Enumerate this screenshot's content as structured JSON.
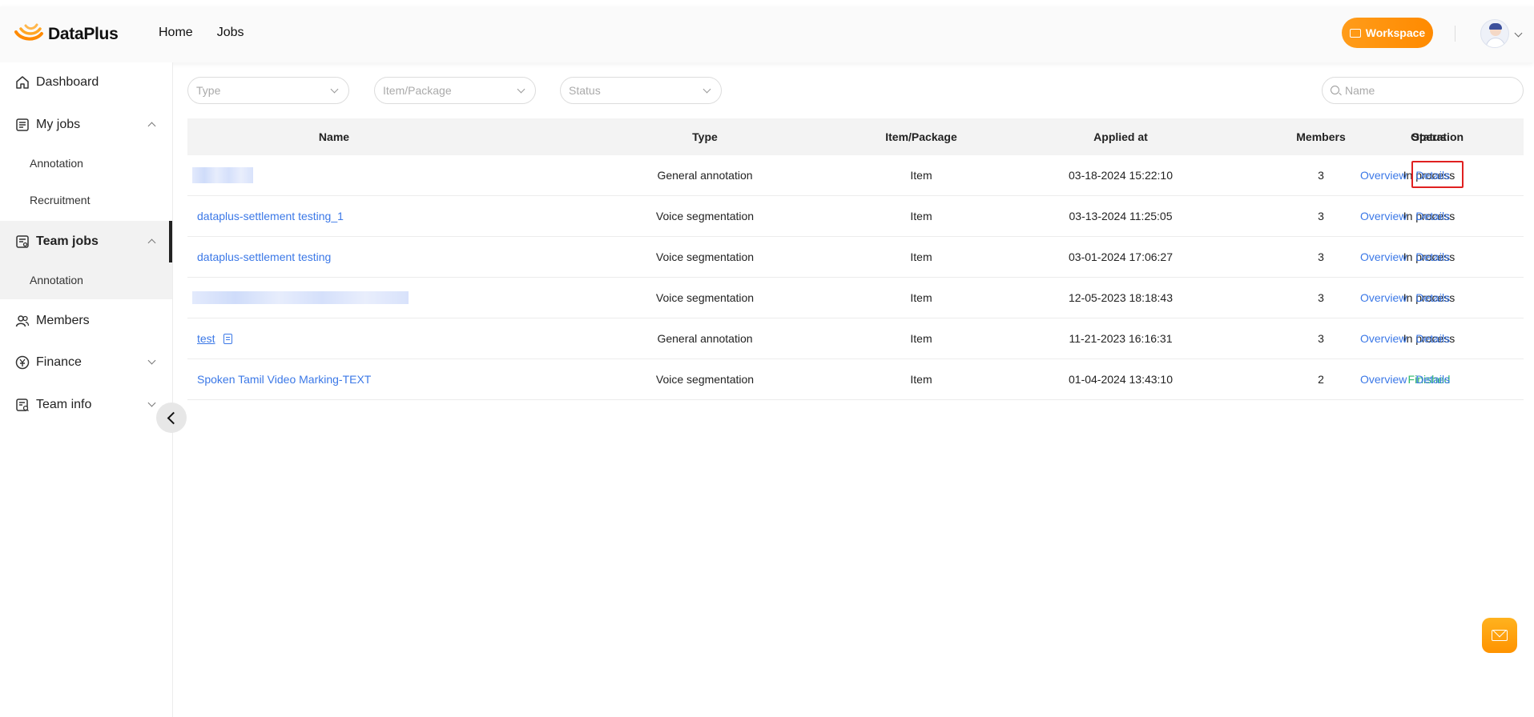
{
  "header": {
    "brand": "DataPlus",
    "nav": [
      "Home",
      "Jobs"
    ],
    "workspace_label": "Workspace"
  },
  "sidebar": {
    "dashboard": "Dashboard",
    "my_jobs": "My jobs",
    "my_jobs_sub": [
      "Annotation",
      "Recruitment"
    ],
    "team_jobs": "Team jobs",
    "team_jobs_sub": [
      "Annotation"
    ],
    "members": "Members",
    "finance": "Finance",
    "team_info": "Team info"
  },
  "filters": {
    "type_placeholder": "Type",
    "item_package_placeholder": "Item/Package",
    "status_placeholder": "Status",
    "name_placeholder": "Name"
  },
  "table": {
    "columns": [
      "Name",
      "Type",
      "Item/Package",
      "Applied at",
      "Members",
      "Status",
      "Operation"
    ],
    "rows": [
      {
        "name": "",
        "type": "General annotation",
        "item": "Item",
        "applied": "03-18-2024 15:22:10",
        "members": "3",
        "status": "In process"
      },
      {
        "name": "dataplus-settlement testing_1",
        "type": "Voice segmentation",
        "item": "Item",
        "applied": "03-13-2024 11:25:05",
        "members": "3",
        "status": "In process"
      },
      {
        "name": "dataplus-settlement testing",
        "type": "Voice segmentation",
        "item": "Item",
        "applied": "03-01-2024 17:06:27",
        "members": "3",
        "status": "In process"
      },
      {
        "name": "",
        "type": "Voice segmentation",
        "item": "Item",
        "applied": "12-05-2023 18:18:43",
        "members": "3",
        "status": "In process"
      },
      {
        "name": "test",
        "type": "General annotation",
        "item": "Item",
        "applied": "11-21-2023 16:16:31",
        "members": "3",
        "status": "In process"
      },
      {
        "name": "Spoken Tamil Video Marking-TEXT",
        "type": "Voice segmentation",
        "item": "Item",
        "applied": "01-04-2024 13:43:10",
        "members": "2",
        "status": "Finished"
      }
    ],
    "op_overview": "Overview",
    "op_details": "Details"
  },
  "colors": {
    "accent": "#ff9300",
    "link": "#3b78e7",
    "finished": "#2fb869",
    "highlight": "#e02020"
  }
}
